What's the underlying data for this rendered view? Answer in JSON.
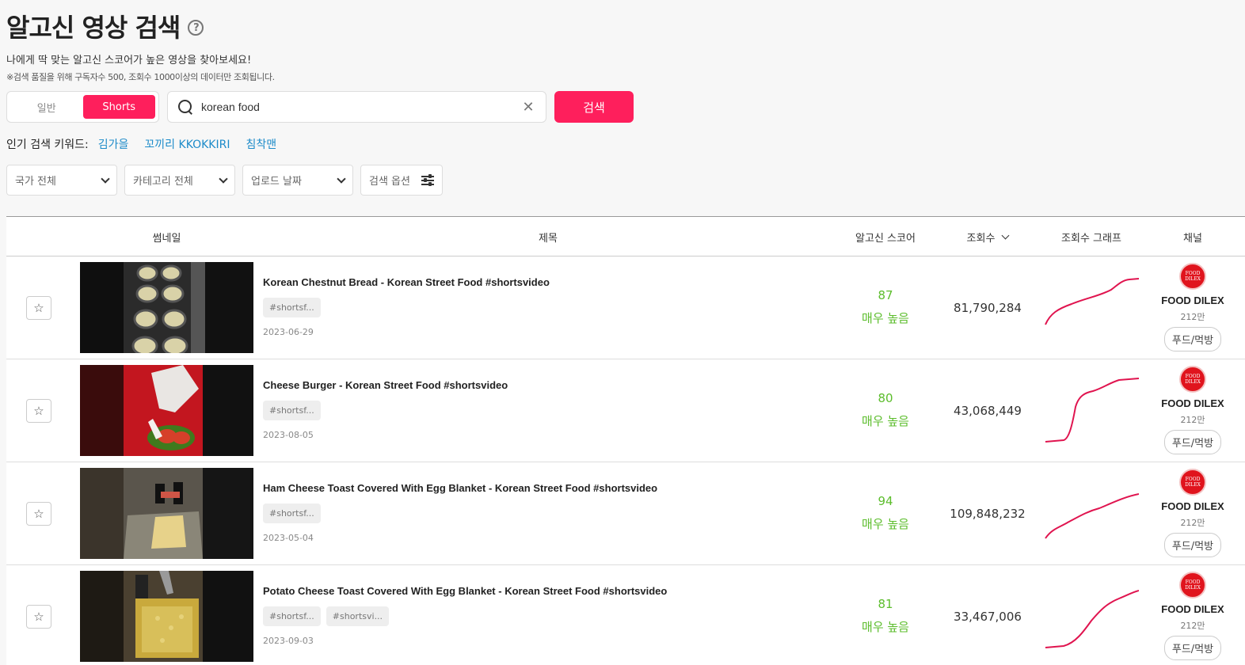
{
  "header": {
    "title": "알고신 영상 검색",
    "help_icon": "?",
    "subtitle": "나에게 딱 맞는 알고신 스코어가 높은 영상을 찾아보세요!",
    "notice": "※검색 품질을 위해 구독자수 500, 조회수 1000이상의 데이터만 조회됩니다."
  },
  "search": {
    "type_general": "일반",
    "type_shorts": "Shorts",
    "query": "korean food",
    "clear_icon": "✕",
    "button_label": "검색"
  },
  "popular": {
    "label": "인기 검색 키워드:",
    "keywords": [
      "김가을",
      "꼬끼리 KKOKKIRI",
      "침착맨"
    ]
  },
  "filters": {
    "country": "국가 전체",
    "category": "카테고리 전체",
    "upload_date": "업로드 날짜",
    "options": "검색 옵션"
  },
  "table": {
    "headers": {
      "thumbnail": "썸네일",
      "title": "제목",
      "score": "알고신 스코어",
      "views": "조회수",
      "graph": "조회수 그래프",
      "channel": "채널"
    },
    "rows": [
      {
        "title": "Korean Chestnut Bread - Korean Street Food #shortsvideo",
        "tags": [
          "#shortsf..."
        ],
        "date": "2023-06-29",
        "score": "87",
        "score_level": "매우 높음",
        "views": "81,790,284",
        "channel": {
          "name": "FOOD DILEX",
          "subs": "212만",
          "category": "푸드/먹방",
          "logo_top": "FOOD",
          "logo_bottom": "DILEX"
        }
      },
      {
        "title": "Cheese Burger - Korean Street Food #shortsvideo",
        "tags": [
          "#shortsf..."
        ],
        "date": "2023-08-05",
        "score": "80",
        "score_level": "매우 높음",
        "views": "43,068,449",
        "channel": {
          "name": "FOOD DILEX",
          "subs": "212만",
          "category": "푸드/먹방",
          "logo_top": "FOOD",
          "logo_bottom": "DILEX"
        }
      },
      {
        "title": "Ham Cheese Toast Covered With Egg Blanket - Korean Street Food #shortsvideo",
        "tags": [
          "#shortsf..."
        ],
        "date": "2023-05-04",
        "score": "94",
        "score_level": "매우 높음",
        "views": "109,848,232",
        "channel": {
          "name": "FOOD DILEX",
          "subs": "212만",
          "category": "푸드/먹방",
          "logo_top": "FOOD",
          "logo_bottom": "DILEX"
        }
      },
      {
        "title": "Potato Cheese Toast Covered With Egg Blanket - Korean Street Food #shortsvideo",
        "tags": [
          "#shortsf...",
          "#shortsvi..."
        ],
        "date": "2023-09-03",
        "score": "81",
        "score_level": "매우 높음",
        "views": "33,467,006",
        "channel": {
          "name": "FOOD DILEX",
          "subs": "212만",
          "category": "푸드/먹방",
          "logo_top": "FOOD",
          "logo_bottom": "DILEX"
        }
      }
    ]
  },
  "colors": {
    "accent": "#fe1f5c",
    "keyword_link": "#1d8bc9",
    "score_green": "#5cbd2c",
    "graph_line": "#e0144f",
    "channel_logo": "#e0141d"
  },
  "icons": {
    "help": "question-circle-icon",
    "search": "magnifier-icon",
    "clear": "close-icon",
    "dropdown": "chevron-down-icon",
    "options": "sliders-icon",
    "favorite": "star-outline-icon",
    "sort": "chevron-down-icon"
  }
}
